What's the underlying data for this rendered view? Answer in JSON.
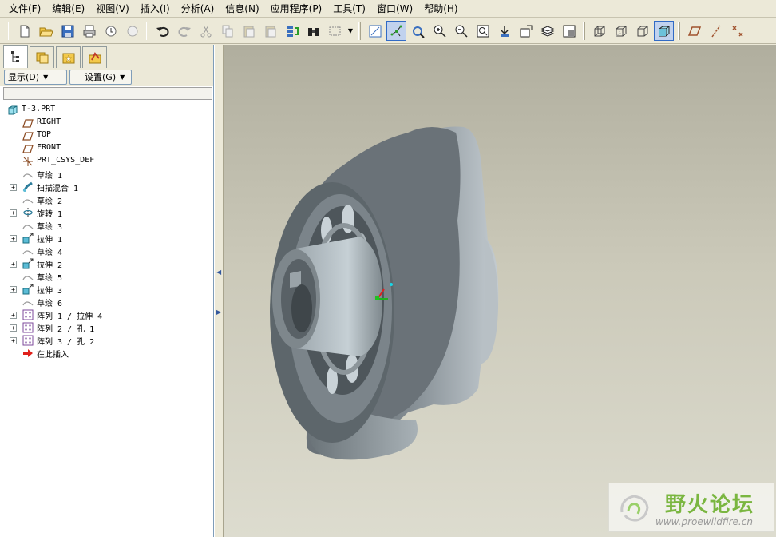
{
  "menubar": {
    "items": [
      "文件(F)",
      "编辑(E)",
      "视图(V)",
      "插入(I)",
      "分析(A)",
      "信息(N)",
      "应用程序(P)",
      "工具(T)",
      "窗口(W)",
      "帮助(H)"
    ]
  },
  "toolbar": {
    "buttons": [
      {
        "name": "new-file-icon"
      },
      {
        "name": "open-folder-icon"
      },
      {
        "name": "save-icon"
      },
      {
        "name": "print-icon"
      },
      {
        "name": "send-mail-icon"
      },
      {
        "name": "send-mail-disabled-icon"
      },
      {
        "name": "undo-icon"
      },
      {
        "name": "redo-icon"
      },
      {
        "name": "cut-icon"
      },
      {
        "name": "copy-icon"
      },
      {
        "name": "paste-icon"
      },
      {
        "name": "paste-special-icon"
      },
      {
        "name": "regenerate-icon"
      },
      {
        "name": "find-binoculars-icon"
      },
      {
        "name": "select-box-icon"
      },
      {
        "name": "repaint-icon"
      },
      {
        "name": "spin-center-icon"
      },
      {
        "name": "orient-mode-icon"
      },
      {
        "name": "zoom-in-icon"
      },
      {
        "name": "zoom-out-icon"
      },
      {
        "name": "refit-icon"
      },
      {
        "name": "reorient-icon"
      },
      {
        "name": "saved-views-icon"
      },
      {
        "name": "layers-icon"
      },
      {
        "name": "view-manager-icon"
      },
      {
        "name": "wireframe-icon"
      },
      {
        "name": "hidden-line-icon"
      },
      {
        "name": "no-hidden-icon"
      },
      {
        "name": "shading-icon"
      },
      {
        "name": "datum-plane-display-icon"
      },
      {
        "name": "datum-axis-display-icon"
      },
      {
        "name": "point-display-icon"
      }
    ]
  },
  "nav": {
    "show_label": "显示(D)",
    "settings_label": "设置(G)"
  },
  "tree": {
    "items": [
      {
        "label": "T-3.PRT",
        "icon": "part-icon",
        "expandable": false,
        "root": true
      },
      {
        "label": "RIGHT",
        "icon": "datum-plane-icon",
        "expandable": false
      },
      {
        "label": "TOP",
        "icon": "datum-plane-icon",
        "expandable": false
      },
      {
        "label": "FRONT",
        "icon": "datum-plane-icon",
        "expandable": false
      },
      {
        "label": "PRT_CSYS_DEF",
        "icon": "csys-icon",
        "expandable": false
      },
      {
        "label": "草绘 1",
        "icon": "sketch-icon",
        "expandable": false
      },
      {
        "label": "扫描混合 1",
        "icon": "swept-blend-icon",
        "expandable": true
      },
      {
        "label": "草绘 2",
        "icon": "sketch-icon",
        "expandable": false
      },
      {
        "label": "旋转 1",
        "icon": "revolve-icon",
        "expandable": true
      },
      {
        "label": "草绘 3",
        "icon": "sketch-icon",
        "expandable": false
      },
      {
        "label": "拉伸 1",
        "icon": "extrude-icon",
        "expandable": true
      },
      {
        "label": "草绘 4",
        "icon": "sketch-icon",
        "expandable": false
      },
      {
        "label": "拉伸 2",
        "icon": "extrude-icon",
        "expandable": true
      },
      {
        "label": "草绘 5",
        "icon": "sketch-icon",
        "expandable": false
      },
      {
        "label": "拉伸 3",
        "icon": "extrude-icon",
        "expandable": true
      },
      {
        "label": "草绘 6",
        "icon": "sketch-icon",
        "expandable": false
      },
      {
        "label": "阵列 1 / 拉伸 4",
        "icon": "pattern-icon",
        "expandable": true
      },
      {
        "label": "阵列 2 / 孔 1",
        "icon": "pattern-icon",
        "expandable": true
      },
      {
        "label": "阵列 3 / 孔 2",
        "icon": "pattern-icon",
        "expandable": true
      },
      {
        "label": "在此插入",
        "icon": "insert-here-arrow-icon",
        "expandable": false
      }
    ]
  },
  "watermark": {
    "title": "野火论坛",
    "url": "www.proewildfire.cn"
  },
  "colors": {
    "viewport_top": "#b0ae9e",
    "viewport_bottom": "#dddccf",
    "model_gray": "#8a9196",
    "insert_arrow": "#e0201b",
    "watermark_green": "#7ab640"
  }
}
